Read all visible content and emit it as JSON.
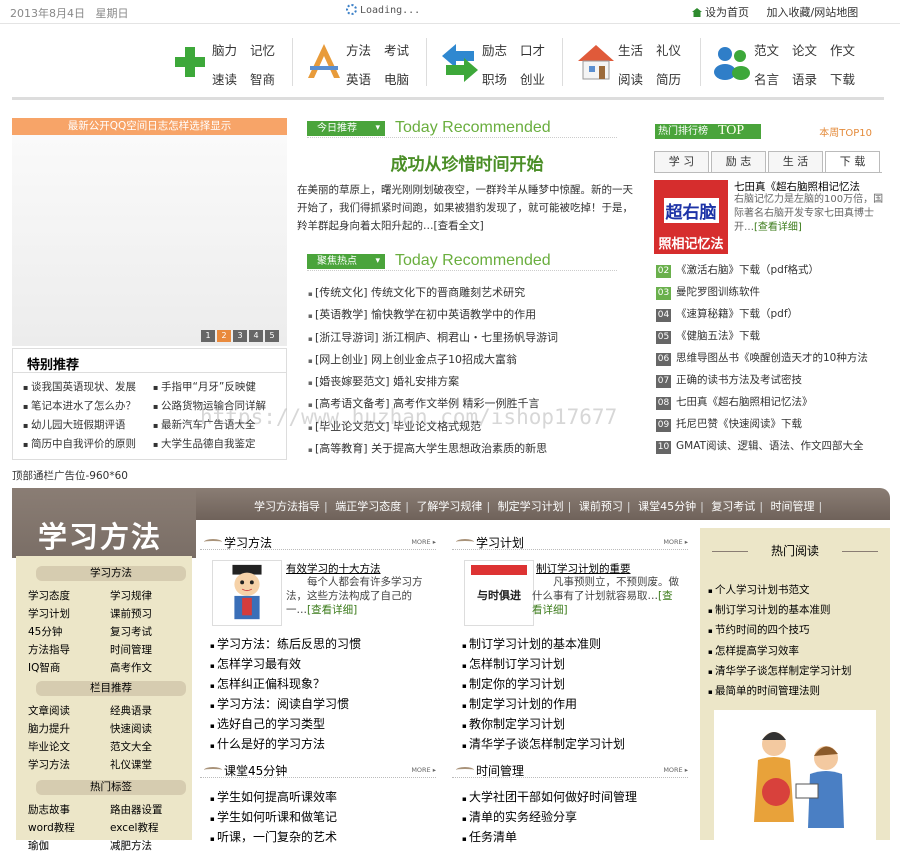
{
  "topbar": {
    "date": "2013年8月4日",
    "weekday": "星期日",
    "loading": "Loading...",
    "set_home": "设为首页",
    "favorite": "加入收藏/网站地图"
  },
  "nav": {
    "groups": [
      {
        "icon": "plus-icon",
        "color": "#3da83a",
        "links": [
          "脑力",
          "记忆",
          "速读",
          "智商"
        ]
      },
      {
        "icon": "ruler-pencil-icon",
        "color": "#e89b3a",
        "links": [
          "方法",
          "考试",
          "英语",
          "电脑"
        ]
      },
      {
        "icon": "refresh-arrows-icon",
        "color": "#2f88d0",
        "links": [
          "励志",
          "口才",
          "职场",
          "创业"
        ]
      },
      {
        "icon": "house-icon",
        "color": "#e05a3a",
        "links": [
          "生活",
          "礼仪",
          "阅读",
          "简历"
        ]
      },
      {
        "icon": "users-icon",
        "color": "#2f7ec8",
        "links": [
          "范文",
          "论文",
          "作文",
          "名言",
          "语录",
          "下载"
        ]
      }
    ]
  },
  "banner": {
    "caption": "最新公开QQ空间日志怎样选择显示",
    "pages": [
      "1",
      "2",
      "3",
      "4",
      "5"
    ],
    "active_page": "2"
  },
  "tejian": {
    "title": "特别推荐",
    "items": [
      "谈我国英语现状、发展",
      "手指甲“月牙”反映健",
      "笔记本进水了怎么办？",
      "公路货物运输合同详解",
      "幼儿园大班假期评语",
      "最新汽车广告语大全",
      "简历中自我评价的原则",
      "大学生品德自我鉴定"
    ]
  },
  "ad_line": "顶部通栏广告位-960*60",
  "today": {
    "tag": "今日推荐",
    "tag_en": "Today Recommended",
    "headline": "成功从珍惜时间开始",
    "lead": "在美丽的草原上，曙光刚刚划破夜空，一群羚羊从睡梦中惊醒。新的一天开始了，我们得抓紧时间跑，如果被猎豹发现了，就可能被吃掉！于是，羚羊群起身向着太阳升起的…",
    "more": "[查看全文]"
  },
  "focus": {
    "tag": "聚焦热点",
    "tag_en": "Today Recommended",
    "items": [
      "[传统文化]  传统文化下的晋商雕刻艺术研究",
      "[英语教学]  愉快教学在初中英语教学中的作用",
      "[浙江导游词]  浙江桐庐、桐君山・七里扬帆导游词",
      "[网上创业]  网上创业金点子10招成大富翁",
      "[婚丧嫁娶范文]  婚礼安排方案",
      "[高考语文备考]  高考作文举例  精彩一例胜千言",
      "[毕业论文范文]  毕业论文格式规范",
      "[高等教育]  关于提高大学生思想政治素质的新思"
    ]
  },
  "hot": {
    "label": "热门排行榜",
    "label_en": "TOP",
    "week": "本周TOP10",
    "tabs": [
      "学  习",
      "励  志",
      "生  活",
      "下  载"
    ],
    "active_tab": "下  载",
    "book": {
      "cover_line1": "超右脑",
      "cover_line2": "照相记忆法",
      "title": "七田真《超右脑照相记忆法",
      "desc": "右脑记忆力是左脑的100万倍，国际著名右脑开发专家七田真博士开…",
      "more": "[查看详细]"
    },
    "ranks": [
      {
        "n": "02",
        "t": "《激活右脑》下载（pdf格式）"
      },
      {
        "n": "03",
        "t": "曼陀罗图训练软件"
      },
      {
        "n": "04",
        "t": "《速算秘籍》下载（pdf）"
      },
      {
        "n": "05",
        "t": "《健脑五法》下载"
      },
      {
        "n": "06",
        "t": "思维导图丛书《唤醒创造天才的10种方法"
      },
      {
        "n": "07",
        "t": "正确的读书方法及考试密技"
      },
      {
        "n": "08",
        "t": "七田真《超右脑照相记忆法》"
      },
      {
        "n": "09",
        "t": "托尼巴赞《快速阅读》下载"
      },
      {
        "n": "10",
        "t": "GMAT阅读、逻辑、语法、作文四部大全"
      }
    ]
  },
  "section": {
    "title": "学习方法",
    "menu": [
      "学习方法指导",
      "端正学习态度",
      "了解学习规律",
      "制定学习计划",
      "课前预习",
      "课堂45分钟",
      "复习考试",
      "时间管理"
    ],
    "left": {
      "h1": "学习方法",
      "g1": [
        "学习态度",
        "学习规律",
        "学习计划",
        "课前预习",
        "45分钟",
        "复习考试",
        "方法指导",
        "时间管理",
        "IQ智商",
        "高考作文"
      ],
      "h2": "栏目推荐",
      "g2": [
        "文章阅读",
        "经典语录",
        "脑力提升",
        "快速阅读",
        "毕业论文",
        "范文大全",
        "学习方法",
        "礼仪课堂"
      ],
      "h3": "热门标签",
      "g3": [
        "励志故事",
        "路由器设置",
        "word教程",
        "excel教程",
        "瑜伽",
        "减肥方法"
      ]
    },
    "p1": {
      "title": "学习方法",
      "more": "MORE ▸",
      "feat_title": "有效学习的十大方法",
      "feat_desc": "每个人都会有许多学习方法，这些方法构成了自己的一…",
      "feat_more": "[查看详细]",
      "items": [
        "学习方法：练后反思的习惯",
        "怎样学习最有效",
        "怎样纠正偏科现象？",
        "学习方法：阅读自学习惯",
        "选好自己的学习类型",
        "什么是好的学习方法"
      ]
    },
    "p2": {
      "title": "学习计划",
      "more": "MORE ▸",
      "img_text": "与时俱进",
      "feat_title": "制订学习计划的重要",
      "feat_desc": "凡事预则立，不预则废。做什么事有了计划就容易取…",
      "feat_more": "[查看详细]",
      "items": [
        "制订学习计划的基本准则",
        "怎样制订学习计划",
        "制定你的学习计划",
        "制定学习计划的作用",
        "教你制定学习计划",
        "清华学子谈怎样制定学习计划"
      ]
    },
    "p3": {
      "title": "课堂45分钟",
      "more": "MORE ▸",
      "items": [
        "学生如何提高听课效率",
        "学生如何听课和做笔记",
        "听课，一门复杂的艺术"
      ]
    },
    "p4": {
      "title": "时间管理",
      "more": "MORE ▸",
      "items": [
        "大学社团干部如何做好时间管理",
        "清单的实务经验分享",
        "任务清单"
      ]
    },
    "right": {
      "title": "热门阅读",
      "items": [
        "个人学习计划书范文",
        "制订学习计划的基本准则",
        "节约时间的四个技巧",
        "怎样提高学习效率",
        "清华学子谈怎样制定学习计划",
        "最简单的时间管理法则"
      ]
    }
  },
  "watermark": "https://www.huzhan.com/ishop17677"
}
